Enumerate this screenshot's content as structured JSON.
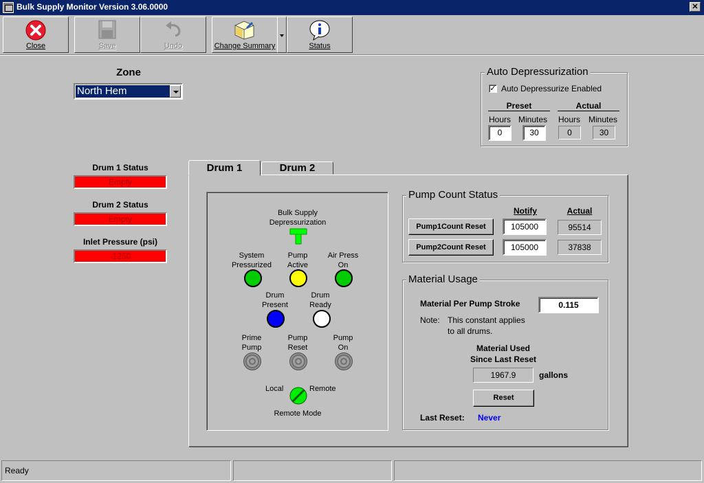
{
  "window": {
    "title": "Bulk Supply Monitor  Version 3.06.0000"
  },
  "toolbar": {
    "close": "Close",
    "save": "Save",
    "undo": "Undo",
    "change_summary": "Change Summary",
    "status": "Status"
  },
  "zone": {
    "label": "Zone",
    "value": "North Hem"
  },
  "auto_depressurization": {
    "title": "Auto Depressurization",
    "enabled_label": "Auto Depressurize Enabled",
    "enabled": true,
    "preset_label": "Preset",
    "actual_label": "Actual",
    "hours_label": "Hours",
    "minutes_label": "Minutes",
    "preset_hours": "0",
    "preset_minutes": "30",
    "actual_hours": "0",
    "actual_minutes": "30"
  },
  "left_status": {
    "drum1_label": "Drum 1 Status",
    "drum1_value": "Empty",
    "drum2_label": "Drum 2 Status",
    "drum2_value": "Empty",
    "inlet_label": "Inlet Pressure (psi)",
    "inlet_value": "-1250"
  },
  "tabs": [
    {
      "label": "Drum 1",
      "active": true
    },
    {
      "label": "Drum 2",
      "active": false
    }
  ],
  "indicators": {
    "bulk_supply": "Bulk Supply",
    "depressurization": "Depressurization",
    "system": "System",
    "pressurized": "Pressurized",
    "pump": "Pump",
    "active": "Active",
    "air_press": "Air Press",
    "on": "On",
    "drum": "Drum",
    "present": "Present",
    "ready": "Ready",
    "prime": "Prime",
    "reset": "Reset",
    "local": "Local",
    "remote": "Remote",
    "remote_mode": "Remote Mode",
    "colors": {
      "green": "#00cc00",
      "yellow": "#ffff00",
      "blue": "#0000ff",
      "white": "#ffffff",
      "off": "#909090"
    }
  },
  "pump_count": {
    "title": "Pump Count Status",
    "notify_label": "Notify",
    "actual_label": "Actual",
    "pump1_reset": "Pump1Count Reset",
    "pump2_reset": "Pump2Count Reset",
    "pump1_notify": "105000",
    "pump1_actual": "95514",
    "pump2_notify": "105000",
    "pump2_actual": "37838"
  },
  "material_usage": {
    "title": "Material Usage",
    "per_stroke_label": "Material Per Pump Stroke",
    "per_stroke_value": "0.115",
    "note_label": "Note:",
    "note_line1": "This constant applies",
    "note_line2": "to all drums.",
    "used_label1": "Material Used",
    "used_label2": "Since Last Reset",
    "used_value": "1967.9",
    "used_units": "gallons",
    "reset_button": "Reset",
    "last_reset_label": "Last Reset:",
    "last_reset_value": "Never"
  },
  "statusbar": {
    "text": "Ready"
  }
}
